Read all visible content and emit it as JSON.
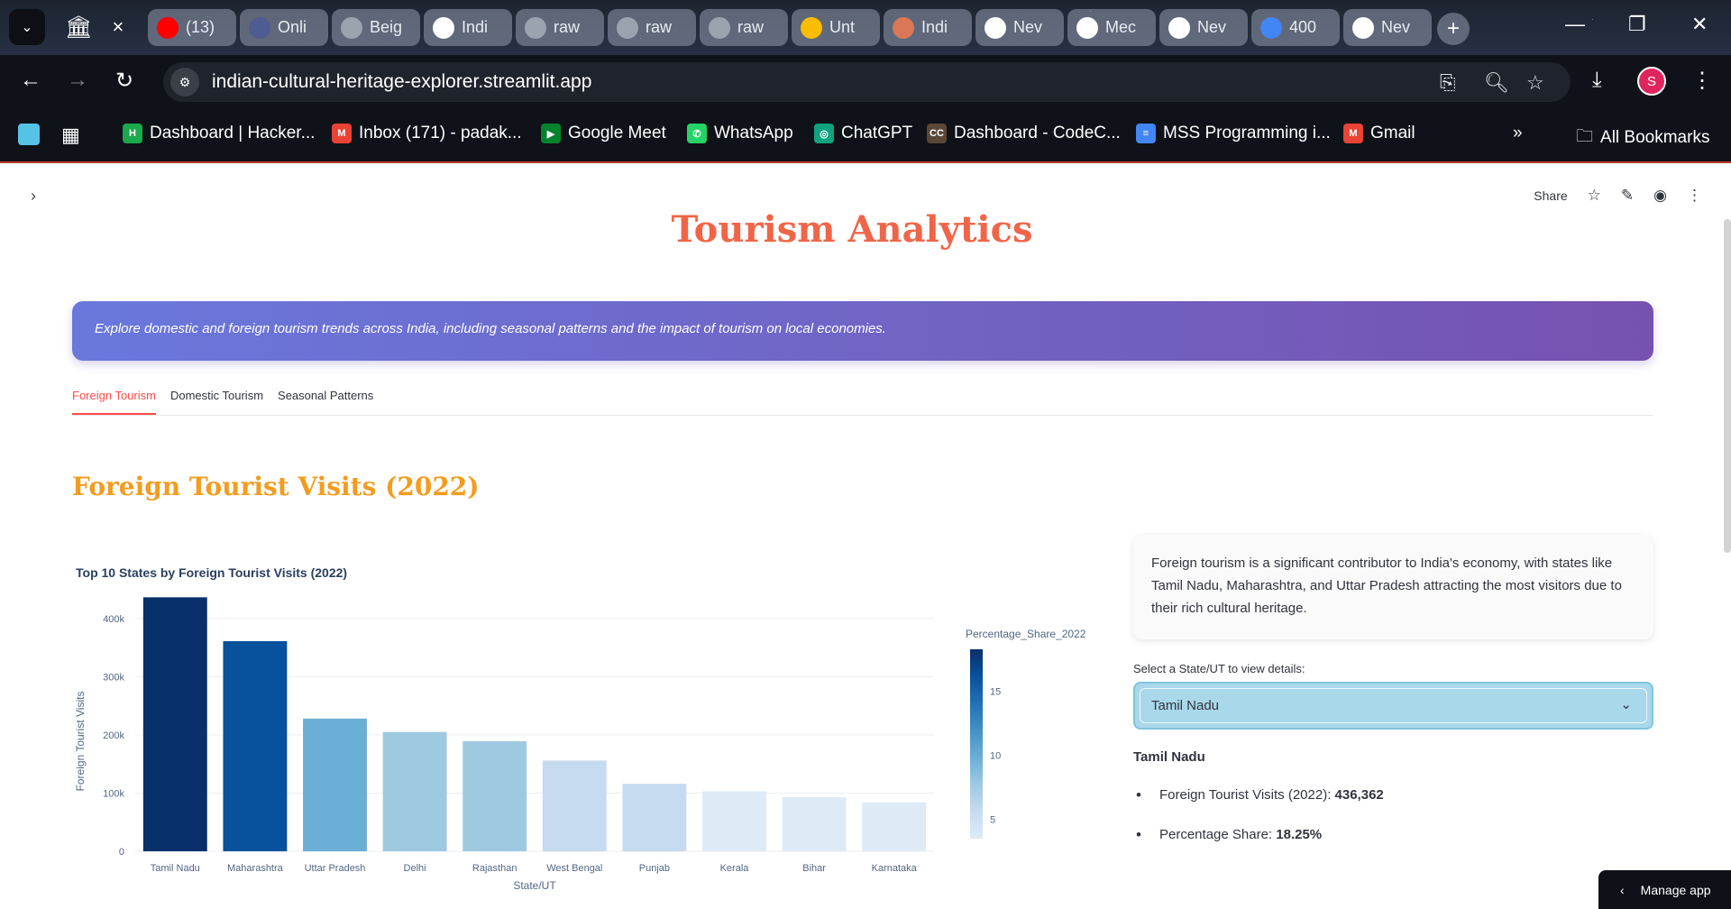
{
  "browser": {
    "active_tab_close": "×",
    "tabs": [
      {
        "label": "(13)",
        "icon": "youtube-icon",
        "color": "#ff0000"
      },
      {
        "label": "Onli",
        "icon": "h-icon",
        "color": "#4f5b93"
      },
      {
        "label": "Beig",
        "icon": "globe-icon",
        "color": "#9aa3b0"
      },
      {
        "label": "Indi",
        "icon": "github-icon",
        "color": "#ffffff"
      },
      {
        "label": "raw",
        "icon": "globe-icon",
        "color": "#9aa3b0"
      },
      {
        "label": "raw",
        "icon": "globe-icon",
        "color": "#9aa3b0"
      },
      {
        "label": "raw",
        "icon": "globe-icon",
        "color": "#9aa3b0"
      },
      {
        "label": "Unt",
        "icon": "drive-icon",
        "color": "#fbbc04"
      },
      {
        "label": "Indi",
        "icon": "claude-icon",
        "color": "#d97757"
      },
      {
        "label": "Nev",
        "icon": "chrome-icon",
        "color": "#ffffff"
      },
      {
        "label": "Mec",
        "icon": "github-icon",
        "color": "#ffffff"
      },
      {
        "label": "Nev",
        "icon": "chrome-icon",
        "color": "#ffffff"
      },
      {
        "label": "400",
        "icon": "google-icon",
        "color": "#4285f4"
      },
      {
        "label": "Nev",
        "icon": "chrome-icon",
        "color": "#ffffff"
      }
    ],
    "url": "indian-cultural-heritage-explorer.streamlit.app",
    "profile_initial": "S",
    "bookmarks": [
      {
        "label": "Dashboard | Hacker...",
        "badge": "H",
        "color": "#1ba94c"
      },
      {
        "label": "Inbox (171) - padak...",
        "badge": "M",
        "color": "#ea4335"
      },
      {
        "label": "Google Meet",
        "badge": "▶",
        "color": "#00832d"
      },
      {
        "label": "WhatsApp",
        "badge": "✆",
        "color": "#25d366"
      },
      {
        "label": "ChatGPT",
        "badge": "◎",
        "color": "#10a37f"
      },
      {
        "label": "Dashboard - CodeC...",
        "badge": "CC",
        "color": "#5b4638"
      },
      {
        "label": "MSS Programming i...",
        "badge": "≡",
        "color": "#4285f4"
      },
      {
        "label": "Gmail",
        "badge": "M",
        "color": "#ea4335"
      }
    ],
    "overflow": "»",
    "all_bookmarks": "All Bookmarks"
  },
  "header": {
    "share_label": "Share"
  },
  "page": {
    "title": "Tourism Analytics",
    "banner_text": "Explore domestic and foreign tourism trends across India, including seasonal patterns and the impact of tourism on local economies.",
    "tabs": [
      {
        "label": "Foreign Tourism",
        "active": true
      },
      {
        "label": "Domestic Tourism",
        "active": false
      },
      {
        "label": "Seasonal Patterns",
        "active": false
      }
    ],
    "section_title": "Foreign Tourist Visits (2022)",
    "info_text": "Foreign tourism is a significant contributor to India's economy, with states like Tamil Nadu, Maharashtra, and Uttar Pradesh attracting the most visitors due to their rich cultural heritage.",
    "select_label": "Select a State/UT to view details:",
    "selected_state": "Tamil Nadu",
    "detail": {
      "name": "Tamil Nadu",
      "visits_label": "Foreign Tourist Visits (2022): ",
      "visits_value": "436,362",
      "share_label": "Percentage Share: ",
      "share_value": "18.25%"
    },
    "manage_app": "Manage app"
  },
  "chart_data": {
    "type": "bar",
    "title": "Top 10 States by Foreign Tourist Visits (2022)",
    "xlabel": "State/UT",
    "ylabel": "Foreign Tourist Visits",
    "categories": [
      "Tamil Nadu",
      "Maharashtra",
      "Uttar Pradesh",
      "Delhi",
      "Rajasthan",
      "West Bengal",
      "Punjab",
      "Kerala",
      "Bihar",
      "Karnataka"
    ],
    "values": [
      436362,
      361000,
      228000,
      205000,
      189000,
      156000,
      116000,
      103000,
      93000,
      84000
    ],
    "ylim": [
      0,
      440000
    ],
    "yticks": [
      0,
      100000,
      200000,
      300000,
      400000
    ],
    "ytick_labels": [
      "0",
      "100k",
      "200k",
      "300k",
      "400k"
    ],
    "colorbar": {
      "title": "Percentage_Share_2022",
      "range": [
        3.5,
        18.25
      ],
      "ticks": [
        5,
        10,
        15
      ],
      "colors": [
        "#deebf7",
        "#c6dbef",
        "#9ecae1",
        "#6baed6",
        "#4292c6",
        "#2171b5",
        "#08519c",
        "#08306b"
      ]
    },
    "grid": true
  }
}
